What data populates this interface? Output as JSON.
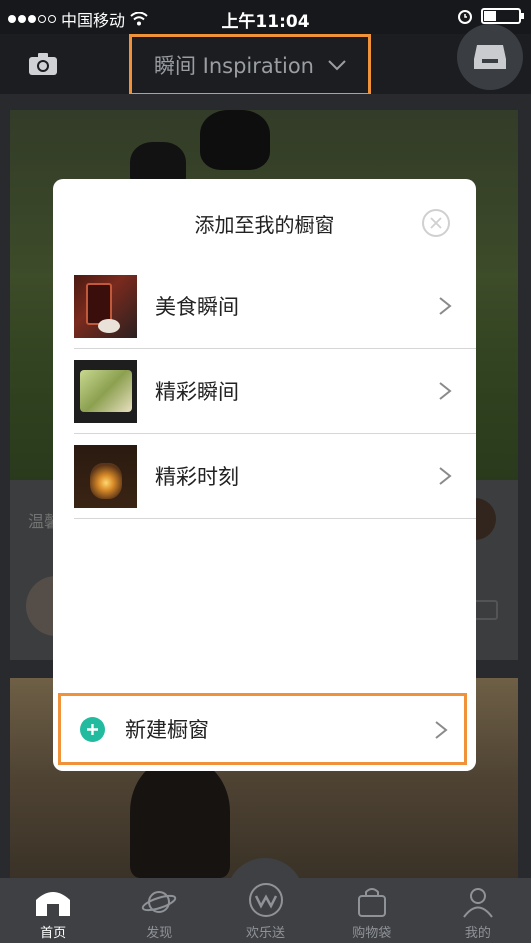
{
  "status_bar": {
    "carrier": "中国移动",
    "time": "上午11:04"
  },
  "nav": {
    "title": "瞬间 Inspiration",
    "camera_icon": "camera-icon",
    "profile_icon": "inbox-icon"
  },
  "feed": {
    "card_text": "温馨"
  },
  "modal": {
    "title": "添加至我的橱窗",
    "items": [
      {
        "label": "美食瞬间",
        "thumb": "drinks-photo"
      },
      {
        "label": "精彩瞬间",
        "thumb": "food-platter-photo"
      },
      {
        "label": "精彩时刻",
        "thumb": "candle-photo"
      }
    ],
    "new_label": "新建橱窗"
  },
  "tabs": [
    {
      "label": "首页",
      "icon": "home-icon",
      "active": true
    },
    {
      "label": "发现",
      "icon": "planet-icon",
      "active": false
    },
    {
      "label": "欢乐送",
      "icon": "w-logo-icon",
      "active": false
    },
    {
      "label": "购物袋",
      "icon": "bag-icon",
      "active": false
    },
    {
      "label": "我的",
      "icon": "person-icon",
      "active": false
    }
  ],
  "colors": {
    "highlight": "#f0923a",
    "plus": "#22bba0"
  }
}
